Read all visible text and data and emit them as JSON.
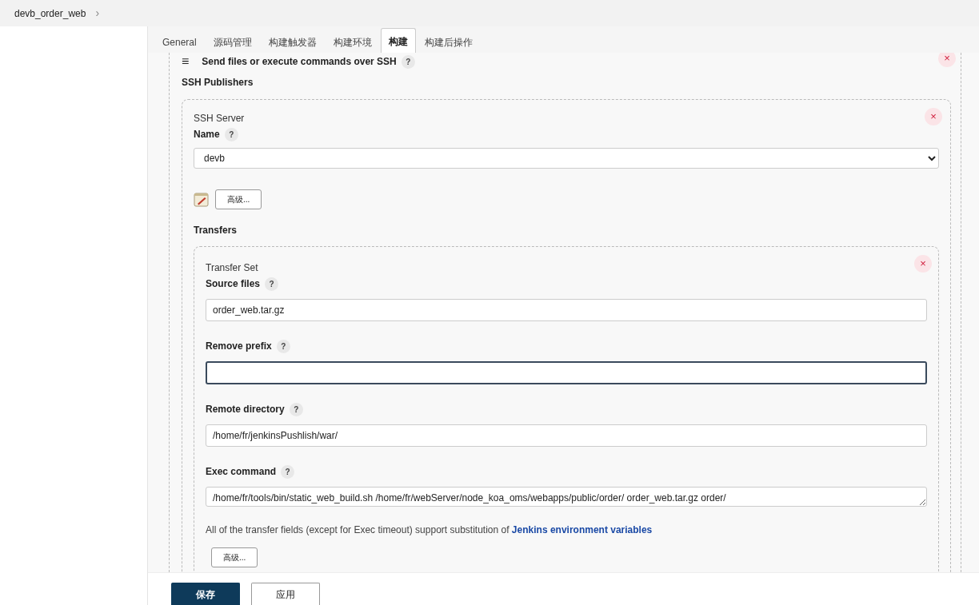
{
  "breadcrumb": {
    "label": "devb_order_web",
    "separator": "›"
  },
  "tabs": [
    {
      "label": "General",
      "selected": false
    },
    {
      "label": "源码管理",
      "selected": false
    },
    {
      "label": "构建触发器",
      "selected": false
    },
    {
      "label": "构建环境",
      "selected": false
    },
    {
      "label": "构建",
      "selected": true
    },
    {
      "label": "构建后操作",
      "selected": false
    }
  ],
  "step": {
    "menu": "≡",
    "title": "Send files or execute commands over SSH",
    "help": "?",
    "close": "×",
    "section": "SSH Publishers",
    "server": {
      "heading": "SSH Server",
      "close": "×",
      "name_label": "Name",
      "help": "?",
      "name_value": "devb",
      "advanced": "高级...",
      "transfers_label": "Transfers",
      "transfer_set": {
        "heading": "Transfer Set",
        "close": "×",
        "fields": [
          {
            "kind": "input",
            "label": "Source files",
            "help": "?",
            "value": "order_web.tar.gz",
            "focused": false
          },
          {
            "kind": "input",
            "label": "Remove prefix",
            "help": "?",
            "focused": true
          },
          {
            "kind": "input",
            "label": "Remote directory",
            "help": "?",
            "value": "/home/fr/jenkinsPushlish/war/",
            "focused": false
          },
          {
            "kind": "textarea",
            "label": "Exec command",
            "help": "?",
            "value": "/home/fr/tools/bin/static_web_build.sh /home/fr/webServer/node_koa_oms/webapps/public/order/ order_web.tar.gz order/",
            "focused": false
          }
        ],
        "note": "All of the transfer fields (except for Exec timeout) support substitution of ",
        "note_link": "Jenkins environment variables",
        "advanced": "高级..."
      }
    }
  },
  "actions": [
    {
      "label": "保存",
      "kind": "primary"
    },
    {
      "label": "应用",
      "kind": "secondary"
    }
  ]
}
